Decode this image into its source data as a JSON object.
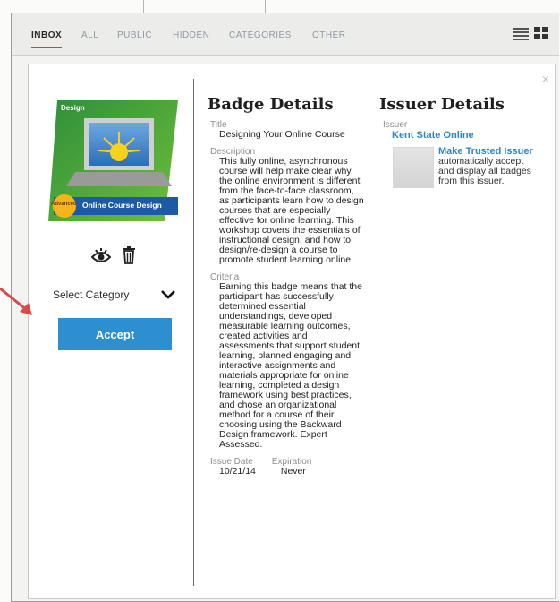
{
  "tabs": [
    {
      "label": "INBOX",
      "active": true
    },
    {
      "label": "ALL",
      "active": false
    },
    {
      "label": "PUBLIC",
      "active": false
    },
    {
      "label": "HIDDEN",
      "active": false
    },
    {
      "label": "CATEGORIES",
      "active": false
    },
    {
      "label": "OTHER",
      "active": false
    }
  ],
  "view_icons": [
    "list-view-icon",
    "grid-view-icon"
  ],
  "modal": {
    "close_icon": "×",
    "badge": {
      "corner_label": "Design",
      "ribbon_prefix": "Advanced",
      "ribbon_text": "Online Course Design"
    },
    "select_category": "Select Category",
    "accept_label": "Accept",
    "badge_details": {
      "heading": "Badge Details",
      "title_label": "Title",
      "title_value": "Designing Your Online Course",
      "description_label": "Description",
      "description_value": "This fully online, asynchronous course will help make clear why the online environment is different from the face-to-face classroom, as participants learn how to design courses that are especially effective for online learning. This workshop covers the essentials of instructional design, and how to design/re-design a course to promote student learning online.",
      "criteria_label": "Criteria",
      "criteria_value": "Earning this badge means that the participant has successfully determined essential understandings, developed measurable learning outcomes, created activities and assessments that support student learning, planned engaging and interactive assignments and materials appropriate for online learning, completed a design framework using best practices, and chose an organizational method for a course of their choosing using the Backward Design framework. Expert Assessed.",
      "issue_date_label": "Issue Date",
      "issue_date_value": "10/21/14",
      "expiration_label": "Expiration",
      "expiration_value": "Never"
    },
    "issuer_details": {
      "heading": "Issuer Details",
      "issuer_label": "Issuer",
      "issuer_name": "Kent State Online",
      "trust_link": "Make Trusted Issuer",
      "trust_text": "automatically accept and display all badges from this issuer."
    }
  },
  "colors": {
    "accent": "#2d8fd0",
    "active_tab": "#d63a5a",
    "link": "#2c86c8",
    "arrow": "#d94a4a"
  }
}
